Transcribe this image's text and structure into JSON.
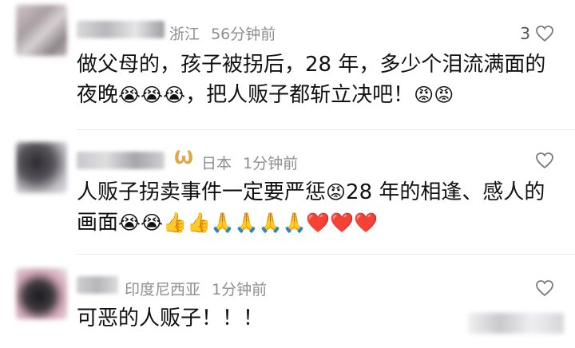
{
  "comments": [
    {
      "location": "浙江",
      "time": "56分钟前",
      "likes": "3",
      "text_line1": "做父母的，孩子被拐后，28 年，多少个泪流满面的",
      "text_line2_a": "夜晚",
      "text_line2_emojis": "😭😭😭",
      "text_line2_b": "，把人贩子都斩立决吧！",
      "text_line2_end_emojis": "😡😡"
    },
    {
      "location": "日本",
      "time": "1分钟前",
      "text_line1_a": "人贩子拐卖事件一定要严惩",
      "text_line1_emoji": "😡",
      "text_line1_b": "28 年的相逢、感人的",
      "text_line2_a": "画面",
      "text_line2_emojis": "😭😭👍👍🙏🙏🙏🙏❤️❤️❤️"
    },
    {
      "location": "印度尼西亚",
      "time": "1分钟前",
      "text": "可恶的人贩子！！！"
    }
  ],
  "colors": {
    "heart_stroke": "#7a7a7f",
    "meta_text": "#8e8e93",
    "vip_badge": "#e0a74a"
  }
}
